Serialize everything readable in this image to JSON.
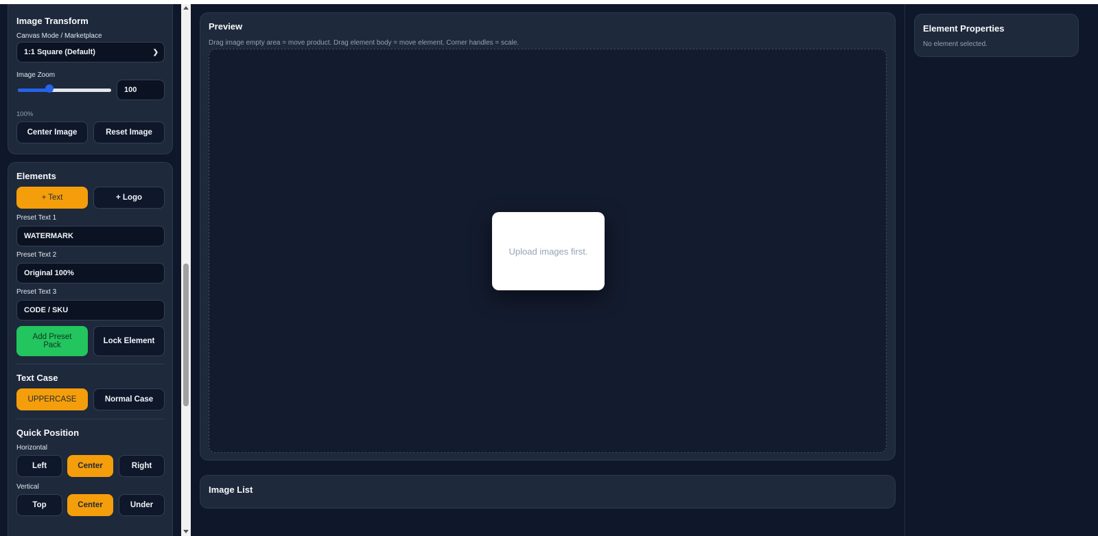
{
  "image_transform": {
    "title": "Image Transform",
    "canvas_mode_label": "Canvas Mode / Marketplace",
    "canvas_mode_value": "1:1 Square (Default)",
    "zoom_label": "Image Zoom",
    "zoom_value": "100",
    "zoom_percent": "100%",
    "zoom_slider_fraction": 0.34,
    "center_button": "Center Image",
    "reset_button": "Reset Image"
  },
  "elements": {
    "title": "Elements",
    "add_text_button": "+ Text",
    "add_logo_button": "+ Logo",
    "preset1_label": "Preset Text 1",
    "preset1_value": "WATERMARK",
    "preset2_label": "Preset Text 2",
    "preset2_value": "Original 100%",
    "preset3_label": "Preset Text 3",
    "preset3_value": "CODE / SKU",
    "add_preset_pack_button": "Add Preset Pack",
    "lock_element_button": "Lock Element",
    "text_case_title": "Text Case",
    "uppercase_button": "UPPERCASE",
    "normal_case_button": "Normal Case",
    "quick_position_title": "Quick Position",
    "horizontal_label": "Horizontal",
    "h_left": "Left",
    "h_center": "Center",
    "h_right": "Right",
    "vertical_label": "Vertical",
    "v_top": "Top",
    "v_center": "Center",
    "v_under": "Under"
  },
  "preview": {
    "title": "Preview",
    "hint": "Drag image empty area = move product. Drag element body = move element. Corner handles = scale.",
    "upload_message": "Upload images first."
  },
  "image_list": {
    "title": "Image List"
  },
  "element_properties": {
    "title": "Element Properties",
    "empty_text": "No element selected."
  },
  "colors": {
    "background": "#0f172a",
    "card": "#1e293b",
    "accent_orange": "#f59e0b",
    "accent_green": "#22c55e",
    "slider_blue": "#2563eb"
  },
  "icons": {
    "select_chevron": "chevron-down-icon",
    "scroll_up": "arrow-up-icon",
    "scroll_down": "arrow-down-icon"
  }
}
